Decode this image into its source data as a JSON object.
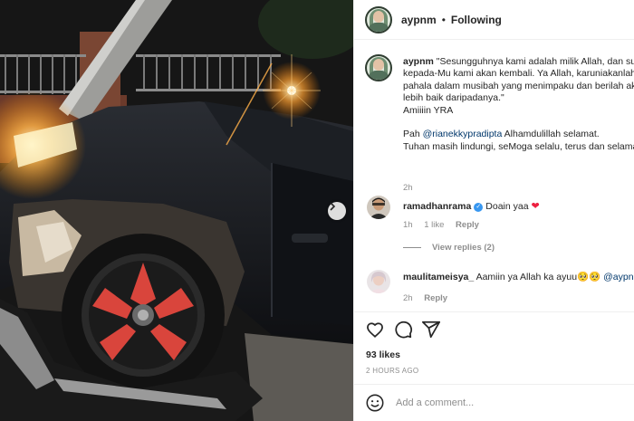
{
  "post": {
    "username": "aypnm",
    "separator": "•",
    "follow_state": "Following"
  },
  "caption": {
    "username": "aypnm",
    "lines": [
      "\"Sesungguhnya kami adalah milik Allah, dan sungguh",
      "kepada-Mu kami akan kembali. Ya Allah, karuniakanlah",
      "pahala dalam musibah yang menimpaku dan berilah aku",
      "lebih baik daripadanya.\"",
      "Amiiiin YRA"
    ],
    "line2_prefix": "Pah ",
    "mention": "@rianekkypradipta",
    "line2_suffix": " Alhamdulillah selamat.",
    "line3": "Tuhan masih lindungi, seMoga selalu, terus dan selamanya",
    "time": "2h"
  },
  "comments": [
    {
      "username": "ramadhanrama",
      "verified": true,
      "text": "Doain yaa",
      "emoji": "❤",
      "time": "1h",
      "likes": "1 like",
      "reply": "Reply",
      "view_replies": "View replies (2)"
    },
    {
      "username": "maulitameisya_",
      "text": "Aamiin ya Allah ka ayuu",
      "emoji": "🥺🥺",
      "mention": "@aypnm",
      "time": "2h",
      "reply": "Reply"
    }
  ],
  "stats": {
    "likes": "93 likes",
    "posted": "2 HOURS AGO"
  },
  "add_comment": {
    "placeholder": "Add a comment..."
  },
  "icons": {
    "like": "heart-icon",
    "comment": "comment-icon",
    "share": "share-icon",
    "emoji": "emoji-icon",
    "next": "chevron-right-icon",
    "verified": "verified-badge-icon"
  },
  "colors": {
    "mention": "#00376b",
    "meta": "#8e8e8e",
    "verified": "#3897f0",
    "heart": "#ed2040"
  }
}
